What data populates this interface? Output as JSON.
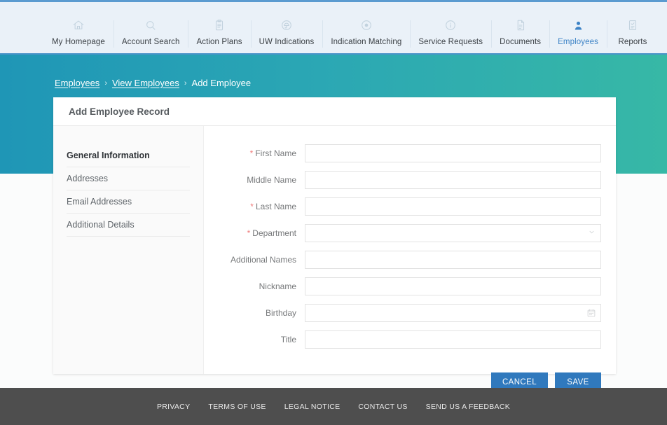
{
  "nav": {
    "items": [
      {
        "label": "My Homepage",
        "icon": "home-icon",
        "active": false
      },
      {
        "label": "Account Search",
        "icon": "search-icon",
        "active": false
      },
      {
        "label": "Action Plans",
        "icon": "clipboard-icon",
        "active": false
      },
      {
        "label": "UW Indications",
        "icon": "umbrella-badge-icon",
        "active": false
      },
      {
        "label": "Indication Matching",
        "icon": "target-icon",
        "active": false
      },
      {
        "label": "Service Requests",
        "icon": "info-icon",
        "active": false
      },
      {
        "label": "Documents",
        "icon": "document-icon",
        "active": false
      },
      {
        "label": "Employees",
        "icon": "person-icon",
        "active": true
      },
      {
        "label": "Reports",
        "icon": "report-icon",
        "active": false
      }
    ],
    "active_color": "#3d83c6"
  },
  "breadcrumb": {
    "items": [
      {
        "label": "Employees",
        "link": true
      },
      {
        "label": "View Employees",
        "link": true
      },
      {
        "label": "Add Employee",
        "link": false
      }
    ],
    "separator": "›"
  },
  "card": {
    "title": "Add Employee Record",
    "sidebar": [
      {
        "label": "General Information",
        "active": true
      },
      {
        "label": "Addresses",
        "active": false
      },
      {
        "label": "Email Addresses",
        "active": false
      },
      {
        "label": "Additional Details",
        "active": false
      }
    ],
    "fields": [
      {
        "label": "First Name",
        "required": true,
        "value": "",
        "placeholder": "",
        "type": "text"
      },
      {
        "label": "Middle Name",
        "required": false,
        "value": "",
        "placeholder": "",
        "type": "text"
      },
      {
        "label": "Last Name",
        "required": true,
        "value": "",
        "placeholder": "",
        "type": "text"
      },
      {
        "label": "Department",
        "required": true,
        "value": "",
        "placeholder": "",
        "type": "select",
        "icon": "chevron-down-icon"
      },
      {
        "label": "Additional Names",
        "required": false,
        "value": "",
        "placeholder": "",
        "type": "text"
      },
      {
        "label": "Nickname",
        "required": false,
        "value": "",
        "placeholder": "",
        "type": "text"
      },
      {
        "label": "Birthday",
        "required": false,
        "value": "",
        "placeholder": "",
        "type": "text",
        "icon": "calendar-icon"
      },
      {
        "label": "Title",
        "required": false,
        "value": "",
        "placeholder": "",
        "type": "text"
      }
    ],
    "required_marker": "*",
    "buttons": [
      {
        "label": "CANCEL",
        "name": "cancel-button"
      },
      {
        "label": "SAVE",
        "name": "save-button"
      }
    ],
    "button_color": "#3079bd"
  },
  "footer": {
    "links": [
      "PRIVACY",
      "TERMS OF USE",
      "LEGAL NOTICE",
      "CONTACT US",
      "SEND US A FEEDBACK"
    ]
  },
  "theme": {
    "teal_left": "#1f96b6",
    "teal_right": "#37b8a6",
    "topbar_bg": "#eaf1f8",
    "footer_bg": "#4e4e4e",
    "required_color": "#ef7b7b"
  }
}
